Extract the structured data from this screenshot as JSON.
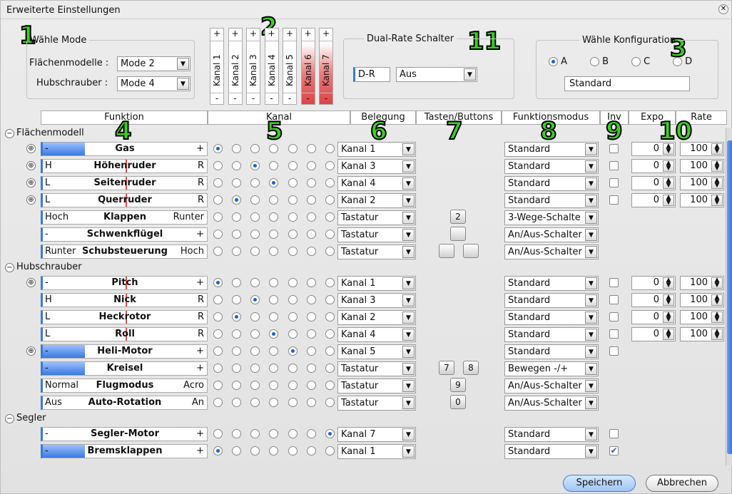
{
  "title": "Erweiterte Einstellungen",
  "callouts": [
    "1",
    "2",
    "3",
    "4",
    "5",
    "6",
    "7",
    "8",
    "9",
    "10",
    "11"
  ],
  "mode": {
    "legend": "Wähle Mode",
    "plane_label": "Flächenmodelle :",
    "plane_value": "Mode 2",
    "heli_label": "Hubschrauber :",
    "heli_value": "Mode 4"
  },
  "channels": [
    {
      "plus": "+",
      "label": "Kanal 1",
      "minus": "-",
      "highlight": false
    },
    {
      "plus": "+",
      "label": "Kanal 2",
      "minus": "-",
      "highlight": false
    },
    {
      "plus": "+",
      "label": "Kanal 3",
      "minus": "-",
      "highlight": false
    },
    {
      "plus": "+",
      "label": "Kanal 4",
      "minus": "-",
      "highlight": false
    },
    {
      "plus": "+",
      "label": "Kanal 5",
      "minus": "-",
      "highlight": false
    },
    {
      "plus": "+",
      "label": "Kanal 6",
      "minus": "-",
      "highlight": true
    },
    {
      "plus": "+",
      "label": "Kanal 7",
      "minus": "-",
      "highlight": true
    }
  ],
  "dualrate": {
    "legend": "Dual-Rate Schalter",
    "tag": "D-R",
    "value": "Aus"
  },
  "config": {
    "legend": "Wähle Konfiguration",
    "options": [
      "A",
      "B",
      "C",
      "D"
    ],
    "selected": "A",
    "name": "Standard"
  },
  "headers": [
    "Funktion",
    "Kanal",
    "Belegung",
    "Tasten/Buttons",
    "Funktionsmodus",
    "Inv",
    "Expo",
    "Rate"
  ],
  "groups": [
    {
      "label": "Flächenmodell",
      "rows": [
        {
          "expand": "⊕",
          "left": "-",
          "name": "Gas",
          "right": "+",
          "bar": 0.5,
          "marker": null,
          "radio": 0,
          "assign": "Kanal 1",
          "keys": [],
          "mode": "Standard",
          "inv": false,
          "expo": "0",
          "rate": "100"
        },
        {
          "expand": "⊕",
          "left": "H",
          "name": "Höhenruder",
          "right": "R",
          "bar": 0,
          "marker": 0.5,
          "radio": 2,
          "assign": "Kanal 3",
          "keys": [],
          "mode": "Standard",
          "inv": false,
          "expo": "0",
          "rate": "100"
        },
        {
          "expand": "⊕",
          "left": "L",
          "name": "Seitenruder",
          "right": "R",
          "bar": 0,
          "marker": 0.5,
          "radio": 3,
          "assign": "Kanal 4",
          "keys": [],
          "mode": "Standard",
          "inv": false,
          "expo": "0",
          "rate": "100"
        },
        {
          "expand": "⊕",
          "left": "L",
          "name": "Querruder",
          "right": "R",
          "bar": 0,
          "marker": 0.5,
          "radio": 1,
          "assign": "Kanal 2",
          "keys": [],
          "mode": "Standard",
          "inv": false,
          "expo": "0",
          "rate": "100"
        },
        {
          "expand": "",
          "left": "Hoch",
          "name": "Klappen",
          "right": "Runter",
          "bar": 0,
          "marker": null,
          "radio": -1,
          "assign": "Tastatur",
          "keys": [
            "2"
          ],
          "mode": "3-Wege-Schalte",
          "inv": null,
          "expo": null,
          "rate": null
        },
        {
          "expand": "",
          "left": "-",
          "name": "Schwenkflügel",
          "right": "+",
          "bar": 0,
          "marker": null,
          "radio": -1,
          "assign": "Tastatur",
          "keys": [
            ""
          ],
          "mode": "An/Aus-Schalter",
          "inv": null,
          "expo": null,
          "rate": null
        },
        {
          "expand": "",
          "left": "Runter",
          "name": "Schubsteuerung",
          "right": "Hoch",
          "bar": 0,
          "marker": null,
          "radio": -1,
          "assign": "Tastatur",
          "keys": [
            "",
            ""
          ],
          "mode": "An/Aus-Schalter",
          "inv": null,
          "expo": null,
          "rate": null
        }
      ]
    },
    {
      "label": "Hubschrauber",
      "rows": [
        {
          "expand": "⊕",
          "left": "-",
          "name": "Pitch",
          "right": "+",
          "bar": 0,
          "marker": 0.5,
          "radio": 0,
          "assign": "Kanal 1",
          "keys": [],
          "mode": "Standard",
          "inv": false,
          "expo": "0",
          "rate": "100"
        },
        {
          "expand": "",
          "left": "H",
          "name": "Nick",
          "right": "R",
          "bar": 0,
          "marker": 0.5,
          "radio": 2,
          "assign": "Kanal 3",
          "keys": [],
          "mode": "Standard",
          "inv": false,
          "expo": "0",
          "rate": "100"
        },
        {
          "expand": "",
          "left": "L",
          "name": "Heckrotor",
          "right": "R",
          "bar": 0,
          "marker": 0.5,
          "radio": 1,
          "assign": "Kanal 2",
          "keys": [],
          "mode": "Standard",
          "inv": false,
          "expo": "0",
          "rate": "100"
        },
        {
          "expand": "",
          "left": "L",
          "name": "Roll",
          "right": "R",
          "bar": 0,
          "marker": 0.5,
          "radio": 3,
          "assign": "Kanal 4",
          "keys": [],
          "mode": "Standard",
          "inv": false,
          "expo": "0",
          "rate": "100"
        },
        {
          "expand": "⊕",
          "left": "-",
          "name": "Heli-Motor",
          "right": "+",
          "bar": 0.5,
          "marker": null,
          "radio": 4,
          "assign": "Kanal 5",
          "keys": [],
          "mode": "Standard",
          "inv": false,
          "expo": null,
          "rate": null
        },
        {
          "expand": "",
          "left": "-",
          "name": "Kreisel",
          "right": "+",
          "bar": 0.5,
          "marker": null,
          "radio": -1,
          "assign": "Tastatur",
          "keys": [
            "7",
            "8"
          ],
          "mode": "Bewegen -/+",
          "inv": null,
          "expo": null,
          "rate": null
        },
        {
          "expand": "",
          "left": "Normal",
          "name": "Flugmodus",
          "right": "Acro",
          "bar": 0,
          "marker": null,
          "radio": -1,
          "assign": "Tastatur",
          "keys": [
            "9"
          ],
          "mode": "An/Aus-Schalter",
          "inv": null,
          "expo": null,
          "rate": null
        },
        {
          "expand": "",
          "left": "Aus",
          "name": "Auto-Rotation",
          "right": "An",
          "bar": 0,
          "marker": null,
          "radio": -1,
          "assign": "Tastatur",
          "keys": [
            "0"
          ],
          "mode": "An/Aus-Schalter",
          "inv": null,
          "expo": null,
          "rate": null
        }
      ]
    },
    {
      "label": "Segler",
      "rows": [
        {
          "expand": "",
          "left": "-",
          "name": "Segler-Motor",
          "right": "+",
          "bar": 0,
          "marker": null,
          "radio": 6,
          "assign": "Kanal 7",
          "keys": [],
          "mode": "Standard",
          "inv": false,
          "expo": null,
          "rate": null
        },
        {
          "expand": "",
          "left": "-",
          "name": "Bremsklappen",
          "right": "+",
          "bar": 0.5,
          "marker": null,
          "radio": 0,
          "assign": "Kanal 1",
          "keys": [],
          "mode": "Standard",
          "inv": true,
          "expo": null,
          "rate": null
        }
      ]
    }
  ],
  "buttons": {
    "save": "Speichern",
    "cancel": "Abbrechen"
  }
}
